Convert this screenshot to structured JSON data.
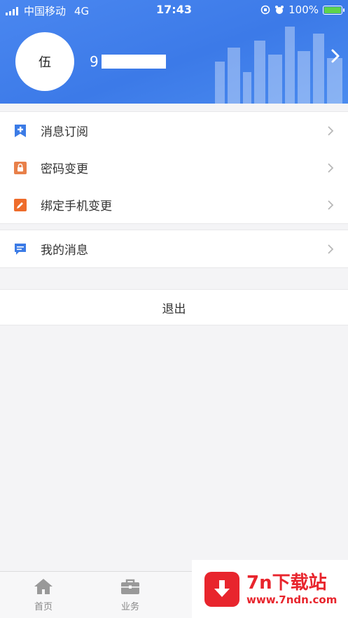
{
  "status_bar": {
    "carrier": "中国移动",
    "network": "4G",
    "time": "17:43",
    "battery_percent": "100%",
    "battery_level": 1.0
  },
  "profile": {
    "avatar_text": "伍",
    "account_prefix": "9"
  },
  "menu_group_1": [
    {
      "label": "消息订阅",
      "icon": "subscribe-bookmark-icon",
      "color": "#3b7be6"
    },
    {
      "label": "密码变更",
      "icon": "lock-icon",
      "color": "#e8804a"
    },
    {
      "label": "绑定手机变更",
      "icon": "edit-pen-icon",
      "color": "#ee6c2b"
    }
  ],
  "menu_group_2": [
    {
      "label": "我的消息",
      "icon": "message-icon",
      "color": "#3b7be6"
    }
  ],
  "logout_label": "退出",
  "tabbar": [
    {
      "label": "首页",
      "icon": "home-icon"
    },
    {
      "label": "业务",
      "icon": "briefcase-icon"
    }
  ],
  "watermark": {
    "title": "7n下载站",
    "url": "www.7ndn.com"
  },
  "colors": {
    "header_blue": "#3c7ae8",
    "accent_red": "#e8252d",
    "page_bg": "#f4f4f6"
  }
}
